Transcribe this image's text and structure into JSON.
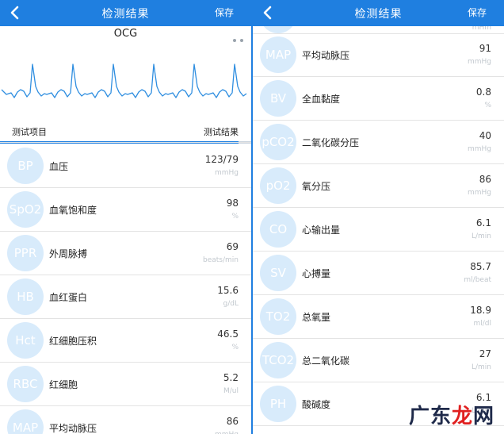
{
  "left": {
    "header": {
      "title": "检测结果",
      "save_label": "保存"
    },
    "ocg": {
      "label": "OCG",
      "progress": 0.95
    },
    "table": {
      "col_item": "测试项目",
      "col_result": "测试结果"
    },
    "rows": [
      {
        "badge": "BP",
        "name": "血压",
        "value": "123/79",
        "unit": "mmHg"
      },
      {
        "badge": "SpO2",
        "name": "血氧饱和度",
        "value": "98",
        "unit": "%"
      },
      {
        "badge": "PPR",
        "name": "外周脉搏",
        "value": "69",
        "unit": "beats/min"
      },
      {
        "badge": "HB",
        "name": "血红蛋白",
        "value": "15.6",
        "unit": "g/dL"
      },
      {
        "badge": "Hct",
        "name": "红细胞压积",
        "value": "46.5",
        "unit": "%"
      },
      {
        "badge": "RBC",
        "name": "红细胞",
        "value": "5.2",
        "unit": "M/ul"
      },
      {
        "badge": "MAP",
        "name": "平均动脉压",
        "value": "86",
        "unit": "mmHg"
      }
    ]
  },
  "right": {
    "header": {
      "title": "检测结果",
      "save_label": "保存"
    },
    "partial_unit": "mHm",
    "rows": [
      {
        "badge": "MAP",
        "name": "平均动脉压",
        "value": "91",
        "unit": "mmHg"
      },
      {
        "badge": "BV",
        "name": "全血黏度",
        "value": "0.8",
        "unit": "%"
      },
      {
        "badge": "pCO2",
        "name": "二氧化碳分压",
        "value": "40",
        "unit": "mmHg"
      },
      {
        "badge": "pO2",
        "name": "氧分压",
        "value": "86",
        "unit": "mmHg"
      },
      {
        "badge": "CO",
        "name": "心输出量",
        "value": "6.1",
        "unit": "L/min"
      },
      {
        "badge": "SV",
        "name": "心搏量",
        "value": "85.7",
        "unit": "ml/beat"
      },
      {
        "badge": "TO2",
        "name": "总氧量",
        "value": "18.9",
        "unit": "ml/dl"
      },
      {
        "badge": "TCO2",
        "name": "总二氧化碳",
        "value": "27",
        "unit": "L/min"
      },
      {
        "badge": "PH",
        "name": "酸碱度",
        "value": "6.1",
        "unit": "L/min"
      }
    ]
  },
  "watermark": {
    "part1": "广东",
    "part2": "龙",
    "part3": "网"
  },
  "colors": {
    "accent": "#1f7fe0",
    "badge_bg": "#d8ebfb",
    "wave": "#2f8ee0"
  },
  "icons": {
    "back": "chevron-left-icon",
    "more": "more-dots-icon"
  }
}
